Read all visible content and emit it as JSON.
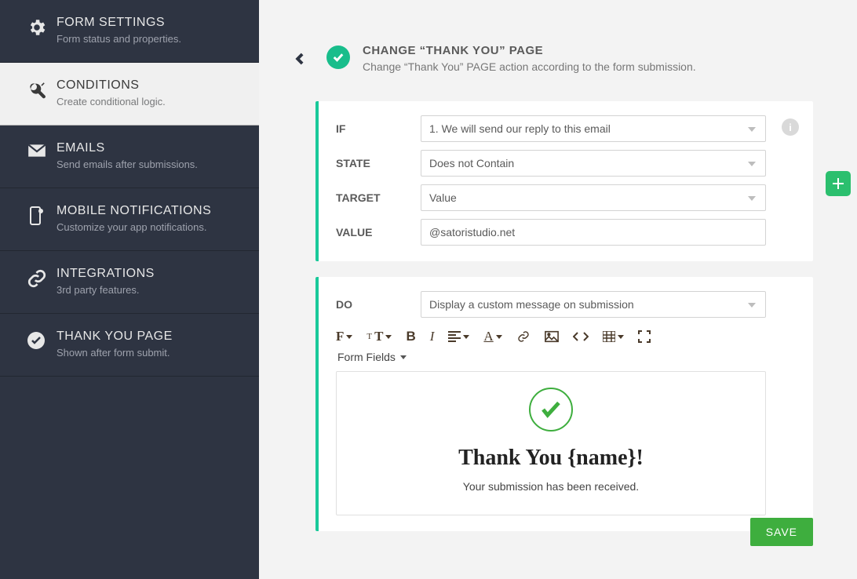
{
  "sidebar": {
    "items": [
      {
        "title": "FORM SETTINGS",
        "sub": "Form status and properties."
      },
      {
        "title": "CONDITIONS",
        "sub": "Create conditional logic."
      },
      {
        "title": "EMAILS",
        "sub": "Send emails after submissions."
      },
      {
        "title": "MOBILE NOTIFICATIONS",
        "sub": "Customize your app notifications."
      },
      {
        "title": "INTEGRATIONS",
        "sub": "3rd party features."
      },
      {
        "title": "THANK YOU PAGE",
        "sub": "Shown after form submit."
      }
    ]
  },
  "header": {
    "title": "CHANGE “THANK YOU” PAGE",
    "sub": "Change “Thank You” PAGE action according to the form submission."
  },
  "condition": {
    "if_label": "IF",
    "if_value": "1. We will send our reply to this email",
    "state_label": "STATE",
    "state_value": "Does not Contain",
    "target_label": "TARGET",
    "target_value": "Value",
    "value_label": "VALUE",
    "value_input": "@satoristudio.net"
  },
  "action": {
    "do_label": "DO",
    "do_value": "Display a custom message on submission",
    "formfields_label": "Form Fields",
    "thankyou_heading": "Thank You {name}!",
    "thankyou_sub": "Your submission has been received."
  },
  "buttons": {
    "save": "SAVE",
    "info": "i"
  },
  "colors": {
    "accent": "#19c99a",
    "sidebar": "#2e3442",
    "save": "#3eae3e"
  }
}
